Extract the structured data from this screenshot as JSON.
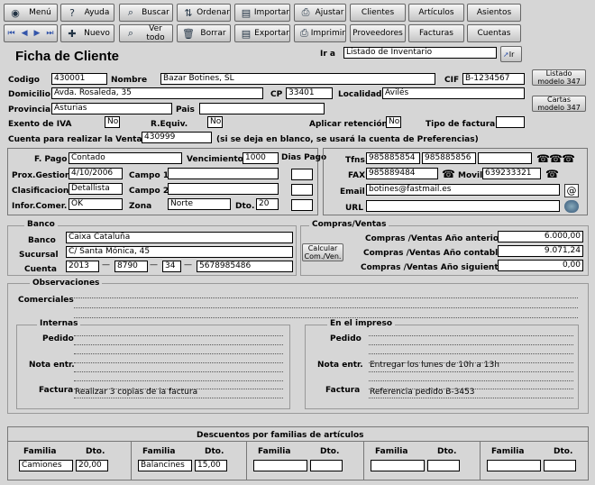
{
  "toolbar": {
    "menu": "Menú",
    "ayuda": "Ayuda",
    "buscar": "Buscar",
    "ordenar": "Ordenar",
    "importar": "Importar",
    "ajustar": "Ajustar",
    "clientes": "Clientes",
    "articulos": "Artículos",
    "asientos": "Asientos",
    "nuevo": "Nuevo",
    "vertodo": "Ver todo",
    "borrar": "Borrar",
    "exportar": "Exportar",
    "imprimir": "Imprimir",
    "proveedores": "Proveedores",
    "facturas": "Facturas",
    "cuentas": "Cuentas"
  },
  "goto": {
    "label": "Ir a",
    "value": "Listado de Inventario",
    "button": "Ir"
  },
  "title": "Ficha de Cliente",
  "side": {
    "listado": "Listado modelo 347",
    "cartas": "Cartas modelo 347"
  },
  "labels": {
    "codigo": "Codigo",
    "nombre": "Nombre",
    "cif": "CIF",
    "domicilio": "Domicilio",
    "cp": "CP",
    "localidad": "Localidad",
    "provincia": "Provincia",
    "pais": "Pais",
    "exento": "Exento de IVA",
    "requiv": "R.Equiv.",
    "aplicar": "Aplicar retención",
    "tipofactura": "Tipo de factura",
    "cuentaventa": "Cuenta  para realizar la Venta",
    "cuentanote": "(si se deja en blanco, se usará la cuenta de Preferencias)",
    "fpago": "F. Pago",
    "vencimiento": "Vencimiento",
    "diaspago": "Dias Pago",
    "proxgestion": "Prox.Gestion",
    "campo1": "Campo 1",
    "clasificacion": "Clasificacion",
    "campo2": "Campo 2",
    "infocomer": "Infor.Comer.",
    "zona": "Zona",
    "dto": "Dto.",
    "tfns": "Tfns.",
    "fax": "FAX",
    "movil": "Movil",
    "email": "Email",
    "url": "URL"
  },
  "values": {
    "codigo": "430001",
    "nombre": "Bazar Botines, SL",
    "cif": "B-1234567",
    "domicilio": "Avda. Rosaleda, 35",
    "cp": "33401",
    "localidad": "Avilés",
    "provincia": "Asturias",
    "pais": "",
    "exento": "No",
    "requiv": "No",
    "aplicar": "No",
    "tipofactura": "",
    "cuentaventa": "430999",
    "fpago": "Contado",
    "vencimiento": "1000",
    "proxgestion": "4/10/2006",
    "clasificacion": "Detallista",
    "infocomer": "OK",
    "zona": "Norte",
    "dto": "20",
    "tfn1": "985885854",
    "tfn2": "985885856",
    "fax": "985889484",
    "movil": "639233321",
    "email": "botines@fastmail.es"
  },
  "banco": {
    "title": "Banco",
    "banco_label": "Banco",
    "sucursal_label": "Sucursal",
    "cuenta_label": "Cuenta",
    "banco": "Caixa Cataluña",
    "sucursal": "C/ Santa Mónica, 45",
    "c1": "2013",
    "c2": "8790",
    "c3": "34",
    "c4": "5678985486"
  },
  "compras": {
    "title": "Compras/Ventas",
    "calc": "Calcular Com./Ven.",
    "anterior_label": "Compras /Ventas Año anterior",
    "contable_label": "Compras /Ventas Año contable",
    "siguiente_label": "Compras /Ventas Año siguiente",
    "anterior": "6.000,00",
    "contable": "9.071,24",
    "siguiente": "0,00"
  },
  "obs": {
    "title": "Observaciones",
    "comerciales": "Comerciales",
    "internas": "Internas",
    "impreso": "En el impreso",
    "pedido": "Pedido",
    "notaentr": "Nota entr.",
    "factura": "Factura",
    "int_factura": "Realizar 3 copias de la factura",
    "imp_notaentr": "Entregar los lunes de 10h a 13h",
    "imp_factura": "Referencia pedido B-3453"
  },
  "descuentos": {
    "title": "Descuentos por familias de artículos",
    "familia": "Familia",
    "dto": "Dto.",
    "rows": [
      {
        "familia": "Camiones",
        "dto": "20,00"
      },
      {
        "familia": "Balancines",
        "dto": "15,00"
      },
      {
        "familia": "",
        "dto": ""
      },
      {
        "familia": "",
        "dto": ""
      },
      {
        "familia": "",
        "dto": ""
      }
    ]
  }
}
